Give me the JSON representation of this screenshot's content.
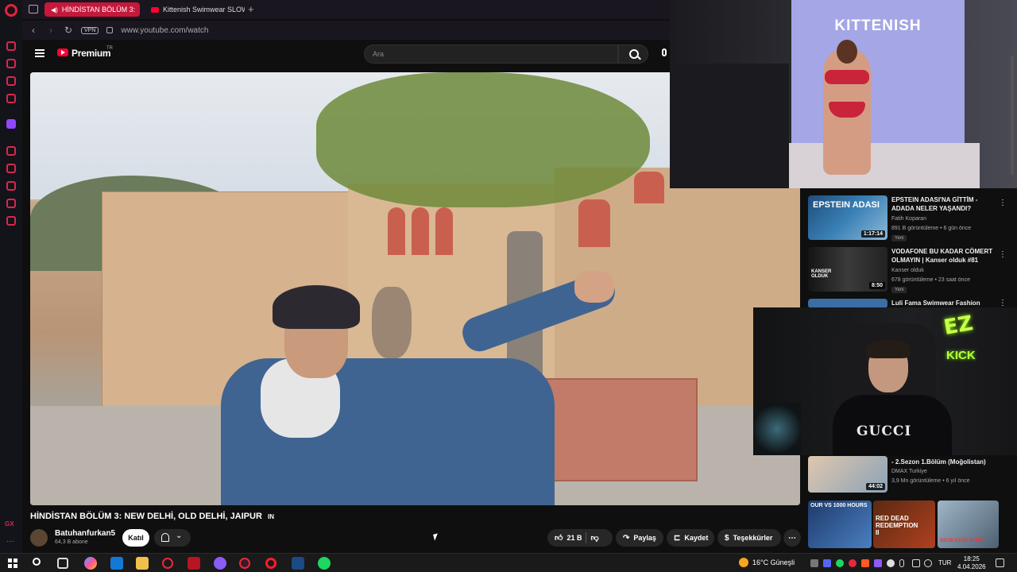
{
  "browser": {
    "tabs": [
      {
        "label": "HİNDİSTAN BÖLÜM 3:",
        "active": true
      },
      {
        "label": "Kittenish Swimwear SLOW",
        "active": false
      }
    ],
    "vpn_label": "VPN",
    "url": "www.youtube.com/watch"
  },
  "youtube": {
    "brand": "Premium",
    "brand_suffix": "TR",
    "search_placeholder": "Ara"
  },
  "video": {
    "title": "HİNDİSTAN BÖLÜM 3: NEW DELHİ, OLD DELHİ, JAIPUR",
    "title_badge": "IN",
    "channel": "Batuhanfurkan5",
    "subscribers": "64,3 B abone",
    "join_label": "Katıl",
    "likes": "21 B",
    "share_label": "Paylaş",
    "save_label": "Kaydet",
    "thanks_label": "Teşekkürler"
  },
  "recommended": [
    {
      "title": "EPSTEIN ADASI'NA GİTTİM - ADADA NELER YAŞANDI?",
      "channel": "Fatih Koparan",
      "meta": "891 B görüntüleme • 6 gün önce",
      "badge": "Yeni",
      "duration": "1:17:14",
      "thumb_text": "EPSTEIN ADASI"
    },
    {
      "title": "VODAFONE BU KADAR CÖMERT OLMAYIN | Kanser olduk #81",
      "channel": "Kanser olduk",
      "meta": "678 görüntüleme • 23 saat önce",
      "badge": "Yeni",
      "duration": "8:50",
      "thumb_text": "KANSER OLDUK"
    },
    {
      "title": "Luli Fama Swimwear Fashion",
      "channel": "",
      "meta": "",
      "badge": "",
      "duration": "",
      "thumb_text": ""
    },
    {
      "title": "- 2.Sezon 1.Bölüm (Moğolistan)",
      "channel": "DMAX Turkiye",
      "meta": "3,9 Mn görüntüleme • 6 yıl önce",
      "badge": "",
      "duration": "44:02",
      "thumb_text": ""
    }
  ],
  "shelf": [
    {
      "text": "OUR VS 1000 HOURS"
    },
    {
      "text": "RED DEAD REDEMPTION II"
    },
    {
      "text": "SSCB DAĞILDI MI?"
    }
  ],
  "overlays": {
    "runway_logo": "KITTENISH",
    "stream_shirt": "GUCCI",
    "neon_top": "EZ",
    "neon_bottom": "KICK"
  },
  "sidebar": {
    "gx_label": "GX",
    "dots": "···"
  },
  "taskbar": {
    "weather": "16°C  Güneşli",
    "language": "TUR",
    "time": "18:25",
    "date": "4.04.2026"
  },
  "colors": {
    "accent": "#ff0033",
    "opera_tab": "#c5183b",
    "neon": "#c7ff4a"
  }
}
